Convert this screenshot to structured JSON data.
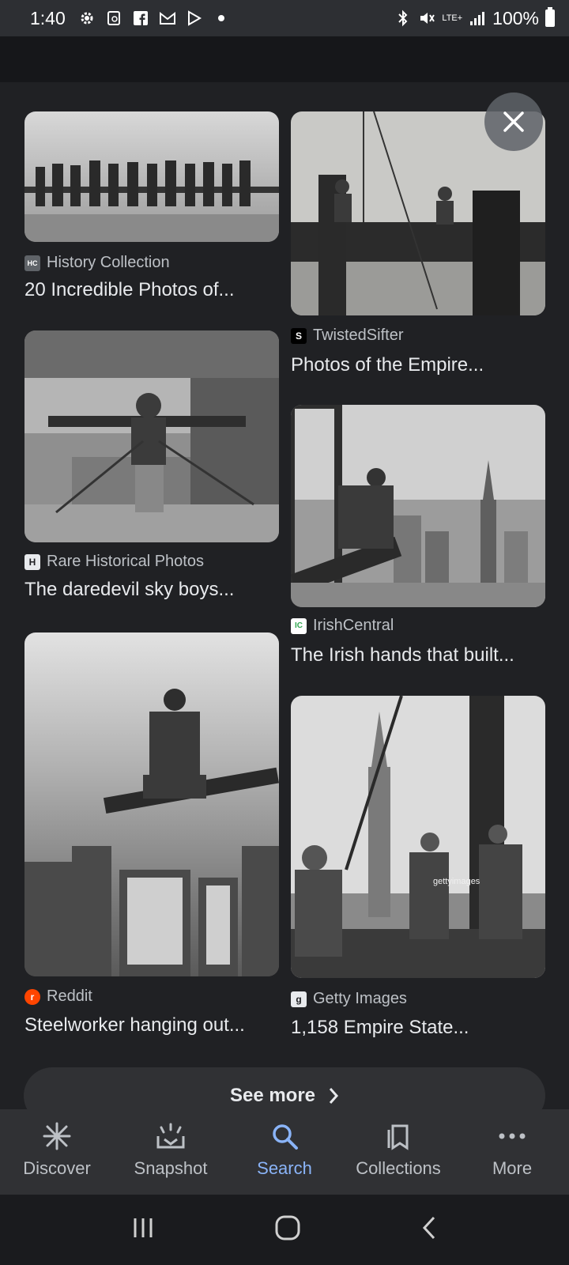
{
  "status_bar": {
    "time": "1:40",
    "battery": "100%",
    "network": "LTE+"
  },
  "results": [
    {
      "source": "History Collection",
      "title": "20 Incredible Photos of...",
      "favicon": "HC",
      "favicon_color": "#5f6368"
    },
    {
      "source": "TwistedSifter",
      "title": "Photos of the Empire...",
      "favicon": "S",
      "favicon_color": "#202124"
    },
    {
      "source": "Rare Historical Photos",
      "title": "The daredevil sky boys...",
      "favicon": "H",
      "favicon_color": "#202124"
    },
    {
      "source": "IrishCentral",
      "title": "The Irish hands that built...",
      "favicon": "IC",
      "favicon_color": "#34a853"
    },
    {
      "source": "Reddit",
      "title": "Steelworker hanging out...",
      "favicon": "r",
      "favicon_color": "#ff4500"
    },
    {
      "source": "Getty Images",
      "title": "1,158 Empire State...",
      "favicon": "g",
      "favicon_color": "#202124"
    }
  ],
  "watermark": "gettyimages",
  "see_more_label": "See more",
  "bottom_nav": [
    {
      "label": "Discover",
      "icon": "asterisk-icon"
    },
    {
      "label": "Snapshot",
      "icon": "snapshot-icon"
    },
    {
      "label": "Search",
      "icon": "search-icon"
    },
    {
      "label": "Collections",
      "icon": "collections-icon"
    },
    {
      "label": "More",
      "icon": "more-dots-icon"
    }
  ],
  "colors": {
    "background": "#202124",
    "active_nav": "#8ab4f8",
    "text": "#e8eaed",
    "secondary_text": "#bdc1c6"
  }
}
